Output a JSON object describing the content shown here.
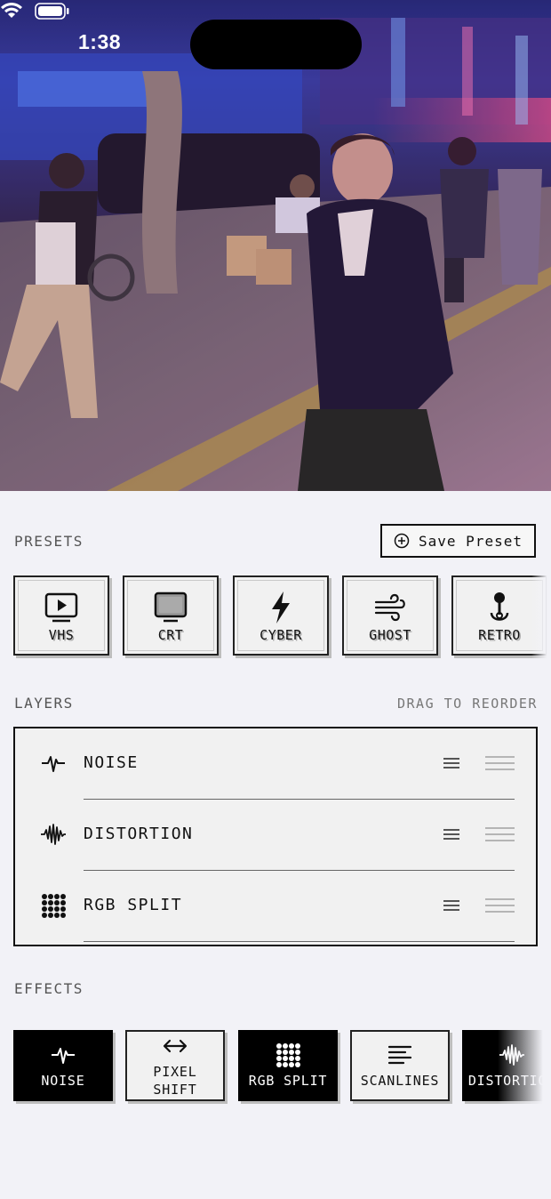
{
  "status_bar": {
    "time": "1:38",
    "icons": [
      "wifi-icon",
      "battery-icon"
    ]
  },
  "presets": {
    "title": "PRESETS",
    "save_label": "Save Preset",
    "items": [
      {
        "label": "VHS",
        "icon": "play-tv-icon"
      },
      {
        "label": "CRT",
        "icon": "monitor-icon"
      },
      {
        "label": "CYBER",
        "icon": "bolt-icon"
      },
      {
        "label": "GHOST",
        "icon": "wind-icon"
      },
      {
        "label": "RETRO",
        "icon": "joystick-icon"
      }
    ]
  },
  "layers": {
    "title": "LAYERS",
    "hint": "DRAG TO REORDER",
    "items": [
      {
        "label": "NOISE",
        "icon": "waveform-icon"
      },
      {
        "label": "DISTORTION",
        "icon": "waveform-dense-icon"
      },
      {
        "label": "RGB SPLIT",
        "icon": "dot-grid-icon"
      }
    ]
  },
  "effects": {
    "title": "EFFECTS",
    "items": [
      {
        "label": "NOISE",
        "icon": "waveform-icon",
        "active": true
      },
      {
        "label": "PIXEL\nSHIFT",
        "icon": "arrows-horizontal-icon",
        "active": false
      },
      {
        "label": "RGB SPLIT",
        "icon": "dot-grid-icon",
        "active": true
      },
      {
        "label": "SCANLINES",
        "icon": "text-lines-icon",
        "active": false
      },
      {
        "label": "DISTORTION",
        "icon": "waveform-dense-icon",
        "active": true
      }
    ]
  }
}
